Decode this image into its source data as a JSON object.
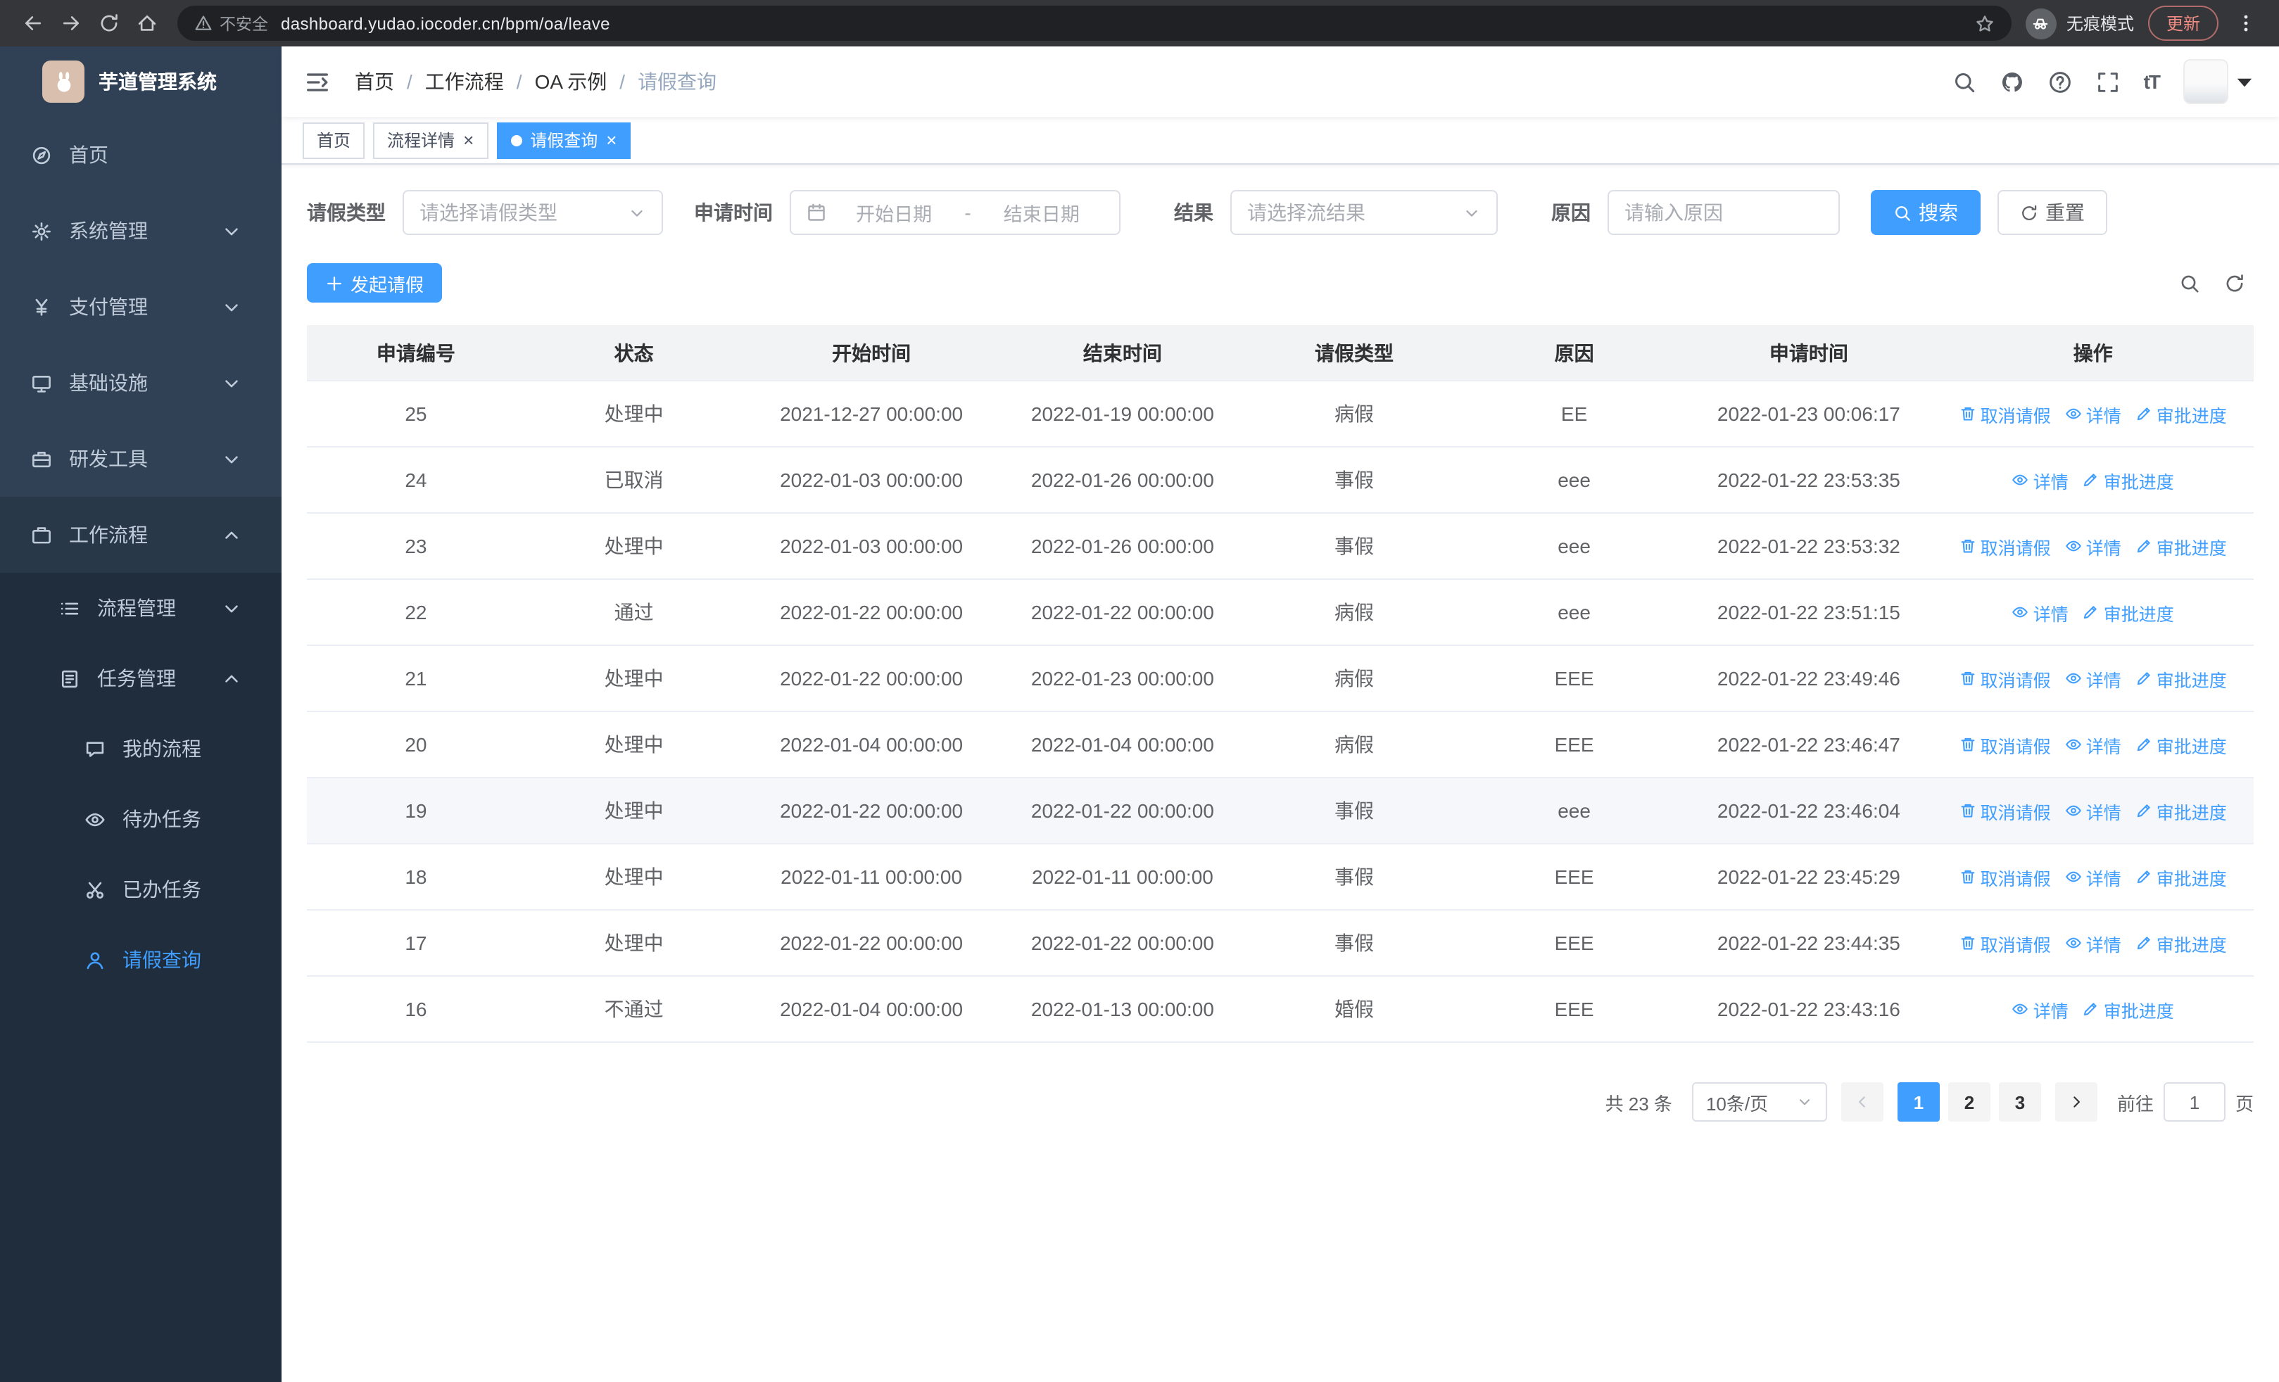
{
  "browser": {
    "security_label": "不安全",
    "url": "dashboard.yudao.iocoder.cn/bpm/oa/leave",
    "incognito_label": "无痕模式",
    "update_label": "更新"
  },
  "sidebar": {
    "logo_title": "芋道管理系统",
    "menu": [
      {
        "label": "首页",
        "icon": "dashboard-icon",
        "level": 1
      },
      {
        "label": "系统管理",
        "icon": "gear-icon",
        "level": 1,
        "chevron": "down"
      },
      {
        "label": "支付管理",
        "icon": "yen-icon",
        "level": 1,
        "chevron": "down"
      },
      {
        "label": "基础设施",
        "icon": "monitor-icon",
        "level": 1,
        "chevron": "down"
      },
      {
        "label": "研发工具",
        "icon": "toolbox-icon",
        "level": 1,
        "chevron": "down"
      },
      {
        "label": "工作流程",
        "icon": "briefcase-icon",
        "level": 1,
        "chevron": "up",
        "expanded": true
      },
      {
        "label": "流程管理",
        "icon": "list-icon",
        "level": 2,
        "chevron": "down"
      },
      {
        "label": "任务管理",
        "icon": "clipboard-icon",
        "level": 2,
        "chevron": "up",
        "expanded": true
      },
      {
        "label": "我的流程",
        "icon": "chat-icon",
        "level": 3
      },
      {
        "label": "待办任务",
        "icon": "eye-icon",
        "level": 3
      },
      {
        "label": "已办任务",
        "icon": "scissors-icon",
        "level": 3
      },
      {
        "label": "请假查询",
        "icon": "user-icon",
        "level": 3,
        "active": true
      }
    ]
  },
  "header": {
    "breadcrumb": [
      "首页",
      "工作流程",
      "OA 示例",
      "请假查询"
    ]
  },
  "tabs": [
    {
      "label": "首页",
      "closable": false,
      "active": false
    },
    {
      "label": "流程详情",
      "closable": true,
      "active": false
    },
    {
      "label": "请假查询",
      "closable": true,
      "active": true
    }
  ],
  "filters": {
    "leave_type_label": "请假类型",
    "leave_type_placeholder": "请选择请假类型",
    "apply_time_label": "申请时间",
    "date_start_placeholder": "开始日期",
    "date_separator": "-",
    "date_end_placeholder": "结束日期",
    "result_label": "结果",
    "result_placeholder": "请选择流结果",
    "reason_label": "原因",
    "reason_placeholder": "请输入原因",
    "search_button": "搜索",
    "reset_button": "重置"
  },
  "toolbar": {
    "create_button": "发起请假"
  },
  "table": {
    "columns": [
      "申请编号",
      "状态",
      "开始时间",
      "结束时间",
      "请假类型",
      "原因",
      "申请时间",
      "操作"
    ],
    "action_labels": {
      "cancel": "取消请假",
      "detail": "详情",
      "progress": "审批进度"
    },
    "rows": [
      {
        "id": "25",
        "status": "处理中",
        "start": "2021-12-27 00:00:00",
        "end": "2022-01-19 00:00:00",
        "type": "病假",
        "reason": "EE",
        "applied": "2022-01-23 00:06:17",
        "actions": [
          "cancel",
          "detail",
          "progress"
        ],
        "highlighted": false
      },
      {
        "id": "24",
        "status": "已取消",
        "start": "2022-01-03 00:00:00",
        "end": "2022-01-26 00:00:00",
        "type": "事假",
        "reason": "eee",
        "applied": "2022-01-22 23:53:35",
        "actions": [
          "detail",
          "progress"
        ],
        "highlighted": false
      },
      {
        "id": "23",
        "status": "处理中",
        "start": "2022-01-03 00:00:00",
        "end": "2022-01-26 00:00:00",
        "type": "事假",
        "reason": "eee",
        "applied": "2022-01-22 23:53:32",
        "actions": [
          "cancel",
          "detail",
          "progress"
        ],
        "highlighted": false
      },
      {
        "id": "22",
        "status": "通过",
        "start": "2022-01-22 00:00:00",
        "end": "2022-01-22 00:00:00",
        "type": "病假",
        "reason": "eee",
        "applied": "2022-01-22 23:51:15",
        "actions": [
          "detail",
          "progress"
        ],
        "highlighted": false
      },
      {
        "id": "21",
        "status": "处理中",
        "start": "2022-01-22 00:00:00",
        "end": "2022-01-23 00:00:00",
        "type": "病假",
        "reason": "EEE",
        "applied": "2022-01-22 23:49:46",
        "actions": [
          "cancel",
          "detail",
          "progress"
        ],
        "highlighted": false
      },
      {
        "id": "20",
        "status": "处理中",
        "start": "2022-01-04 00:00:00",
        "end": "2022-01-04 00:00:00",
        "type": "病假",
        "reason": "EEE",
        "applied": "2022-01-22 23:46:47",
        "actions": [
          "cancel",
          "detail",
          "progress"
        ],
        "highlighted": false
      },
      {
        "id": "19",
        "status": "处理中",
        "start": "2022-01-22 00:00:00",
        "end": "2022-01-22 00:00:00",
        "type": "事假",
        "reason": "eee",
        "applied": "2022-01-22 23:46:04",
        "actions": [
          "cancel",
          "detail",
          "progress"
        ],
        "highlighted": true
      },
      {
        "id": "18",
        "status": "处理中",
        "start": "2022-01-11 00:00:00",
        "end": "2022-01-11 00:00:00",
        "type": "事假",
        "reason": "EEE",
        "applied": "2022-01-22 23:45:29",
        "actions": [
          "cancel",
          "detail",
          "progress"
        ],
        "highlighted": false
      },
      {
        "id": "17",
        "status": "处理中",
        "start": "2022-01-22 00:00:00",
        "end": "2022-01-22 00:00:00",
        "type": "事假",
        "reason": "EEE",
        "applied": "2022-01-22 23:44:35",
        "actions": [
          "cancel",
          "detail",
          "progress"
        ],
        "highlighted": false
      },
      {
        "id": "16",
        "status": "不通过",
        "start": "2022-01-04 00:00:00",
        "end": "2022-01-13 00:00:00",
        "type": "婚假",
        "reason": "EEE",
        "applied": "2022-01-22 23:43:16",
        "actions": [
          "detail",
          "progress"
        ],
        "highlighted": false
      }
    ]
  },
  "pagination": {
    "total_label": "共 23 条",
    "page_size": "10条/页",
    "pages": [
      "1",
      "2",
      "3"
    ],
    "active_page": "1",
    "goto_label": "前往",
    "goto_value": "1",
    "goto_suffix": "页"
  },
  "colors": {
    "primary": "#409eff",
    "sidebar_bg": "#304156",
    "sidebar_submenu_bg": "#1f2d3d",
    "table_header_bg": "#f2f3f5"
  }
}
